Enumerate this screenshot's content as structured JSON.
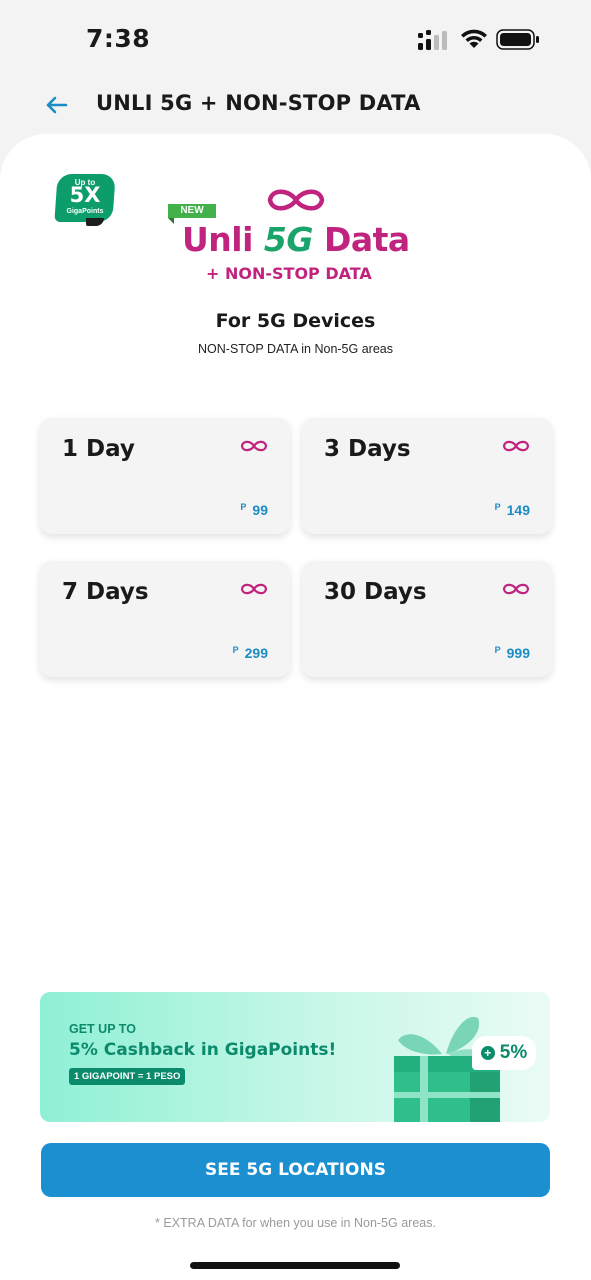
{
  "status_bar": {
    "time": "7:38"
  },
  "header": {
    "title": "UNLI 5G + NON-STOP DATA"
  },
  "badge": {
    "line1": "Up to",
    "line2": "5X",
    "line3": "GigaPoints"
  },
  "logo": {
    "new_tag": "NEW",
    "title_part1": "Unli ",
    "title_5g": "5G",
    "title_part2": " Data",
    "subtitle": "+ NON-STOP DATA"
  },
  "devices": {
    "title": "For 5G Devices",
    "subtitle": "NON-STOP DATA in Non-5G areas"
  },
  "plans": [
    {
      "name": "1 Day",
      "currency": "P",
      "price": "99"
    },
    {
      "name": "3 Days",
      "currency": "P",
      "price": "149"
    },
    {
      "name": "7 Days",
      "currency": "P",
      "price": "299"
    },
    {
      "name": "30 Days",
      "currency": "P",
      "price": "999"
    }
  ],
  "promo": {
    "line1": "GET UP TO",
    "line2": "5% Cashback in GigaPoints!",
    "tag": "1 GIGAPOINT = 1 PESO",
    "badge_plus": "+",
    "badge_value": "5%"
  },
  "cta": {
    "label": "SEE 5G LOCATIONS"
  },
  "footnote": "* EXTRA DATA for when you use in Non-5G areas.",
  "colors": {
    "accent_pink": "#c0247e",
    "accent_green": "#0c8a6c",
    "price_blue": "#1b8cc4",
    "cta_blue": "#1b8fd0"
  }
}
